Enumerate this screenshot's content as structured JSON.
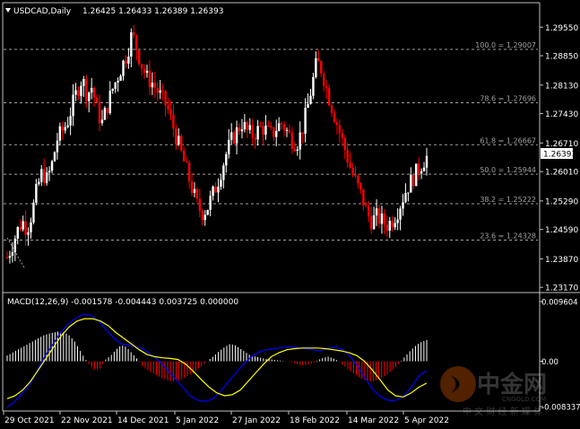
{
  "header": {
    "symbol_tf": "USDCAD,Daily",
    "ohlc": "1.26425 1.26433 1.26389 1.26393"
  },
  "macd_header": "MACD(12,26,9) -0.001578 -0.004443 0.003725 0.000000",
  "current_price_label": "1.26393",
  "watermark": {
    "main": "中金网",
    "domain": "CNGOLD.COM",
    "sub": "中 文 财 经 新 媒 体"
  },
  "colors": {
    "background": "#000000",
    "axis": "#c0c0c0",
    "text": "#ffffff",
    "bull_candle": "#ffffff",
    "bear_candle": "#ff0000",
    "fib_lines": "#a0a0a0",
    "macd_positive": "#ffffff",
    "macd_negative": "#ff0000",
    "macd_line": "#0000ff",
    "signal_line": "#ffff00"
  },
  "chart_data": [
    {
      "type": "candlestick",
      "title": "USDCAD,Daily",
      "x_tick_labels": [
        "29 Oct 2021",
        "22 Nov 2021",
        "14 Dec 2021",
        "5 Jan 2022",
        "27 Jan 2022",
        "18 Feb 2022",
        "14 Mar 2022",
        "5 Apr 2022"
      ],
      "y_tick_labels": [
        "1.29550",
        "1.28850",
        "1.28130",
        "1.27430",
        "1.26710",
        "1.26010",
        "1.25290",
        "1.24590",
        "1.23870",
        "1.23170"
      ],
      "ylim": [
        1.2313,
        1.2982
      ],
      "last_price": 1.26393,
      "fibonacci_levels": [
        {
          "label": "100.0 = 1.29007",
          "value": 1.29007
        },
        {
          "label": "78.6 = 1.27696",
          "value": 1.27696
        },
        {
          "label": "61.8 = 1.26667",
          "value": 1.26667
        },
        {
          "label": "50.0 = 1.25944",
          "value": 1.25944
        },
        {
          "label": "38.2 = 1.25222",
          "value": 1.25222
        },
        {
          "label": "23.6 = 1.24328",
          "value": 1.24328
        }
      ],
      "close_path": [
        1.239,
        1.242,
        1.2455,
        1.248,
        1.246,
        1.25,
        1.256,
        1.26,
        1.258,
        1.262,
        1.268,
        1.27,
        1.272,
        1.276,
        1.28,
        1.283,
        1.279,
        1.281,
        1.275,
        1.272,
        1.276,
        1.28,
        1.283,
        1.286,
        1.289,
        1.294,
        1.29,
        1.286,
        1.283,
        1.282,
        1.28,
        1.278,
        1.276,
        1.272,
        1.268,
        1.264,
        1.26,
        1.256,
        1.252,
        1.25,
        1.251,
        1.254,
        1.257,
        1.261,
        1.265,
        1.268,
        1.27,
        1.272,
        1.27,
        1.269,
        1.27,
        1.271,
        1.27,
        1.269,
        1.271,
        1.272,
        1.27,
        1.268,
        1.267,
        1.27,
        1.275,
        1.281,
        1.287,
        1.285,
        1.28,
        1.276,
        1.272,
        1.268,
        1.264,
        1.26,
        1.257,
        1.254,
        1.25,
        1.248,
        1.249,
        1.248,
        1.247,
        1.248,
        1.25,
        1.253,
        1.256,
        1.258,
        1.26,
        1.262,
        1.2639
      ]
    },
    {
      "type": "bar",
      "title": "MACD(12,26,9) -0.001578 -0.004443 0.003725 0.000000",
      "ylim": [
        -0.008337,
        0.009604
      ],
      "y_tick_labels": [
        "0.009604",
        "0.00",
        "-0.008337"
      ],
      "macd_histogram": [
        0.001,
        0.0015,
        0.002,
        0.0025,
        0.003,
        0.0035,
        0.004,
        0.0045,
        0.0048,
        0.005,
        0.0052,
        0.005,
        0.0045,
        0.0035,
        0.002,
        0.0005,
        -0.0008,
        -0.0015,
        -0.0012,
        0.0003,
        0.001,
        0.002,
        0.0028,
        0.0025,
        0.0015,
        0.0005,
        -0.0008,
        -0.0015,
        -0.002,
        -0.0025,
        -0.003,
        -0.0033,
        -0.0035,
        -0.0034,
        -0.003,
        -0.0025,
        -0.002,
        -0.0012,
        -0.0005,
        0.0003,
        0.001,
        0.0018,
        0.0025,
        0.003,
        0.0028,
        0.0022,
        0.0016,
        0.001,
        0.0008,
        0.0006,
        0.0004,
        0.0003,
        0.0002,
        0.0001,
        0.0,
        -0.0002,
        -0.0005,
        -0.0008,
        -0.0006,
        -0.0003,
        0.0002,
        0.0006,
        0.0008,
        0.0005,
        0.0,
        -0.0008,
        -0.0015,
        -0.0022,
        -0.0028,
        -0.0032,
        -0.0035,
        -0.0034,
        -0.003,
        -0.0025,
        -0.0018,
        -0.001,
        0.0,
        0.001,
        0.002,
        0.0028,
        0.0034,
        0.0037
      ],
      "signal_line": [
        -0.0065,
        -0.006,
        -0.005,
        -0.0035,
        -0.0015,
        0.0005,
        0.0025,
        0.0045,
        0.006,
        0.007,
        0.0074,
        0.0074,
        0.007,
        0.0062,
        0.005,
        0.004,
        0.003,
        0.002,
        0.0012,
        0.0008,
        0.0006,
        0.0005,
        0.0003,
        -0.0005,
        -0.0018,
        -0.0032,
        -0.0045,
        -0.0055,
        -0.006,
        -0.0058,
        -0.005,
        -0.0035,
        -0.002,
        -0.0005,
        0.0008,
        0.0015,
        0.002,
        0.0022,
        0.0023,
        0.0023,
        0.0023,
        0.0022,
        0.002,
        0.0018,
        0.0015,
        0.001,
        0.0,
        -0.0015,
        -0.0032,
        -0.005,
        -0.006,
        -0.0062,
        -0.0055,
        -0.0045,
        -0.0038
      ],
      "macd_line": [
        -0.008,
        -0.007,
        -0.0055,
        -0.004,
        -0.0015,
        0.001,
        0.003,
        0.005,
        0.0065,
        0.0075,
        0.0082,
        0.008,
        0.007,
        0.0055,
        0.004,
        0.003,
        0.0028,
        0.0025,
        0.002,
        0.001,
        0.0,
        -0.0015,
        -0.003,
        -0.0045,
        -0.006,
        -0.0068,
        -0.007,
        -0.0065,
        -0.0052,
        -0.0035,
        -0.002,
        -0.0005,
        0.0008,
        0.0016,
        0.002,
        0.0022,
        0.0024,
        0.0025,
        0.0024,
        0.0022,
        0.002,
        0.0018,
        0.0022,
        0.0025,
        0.002,
        0.0008,
        -0.001,
        -0.003,
        -0.005,
        -0.0062,
        -0.0068,
        -0.0068,
        -0.006,
        -0.0045,
        -0.0025,
        -0.0016
      ]
    }
  ]
}
